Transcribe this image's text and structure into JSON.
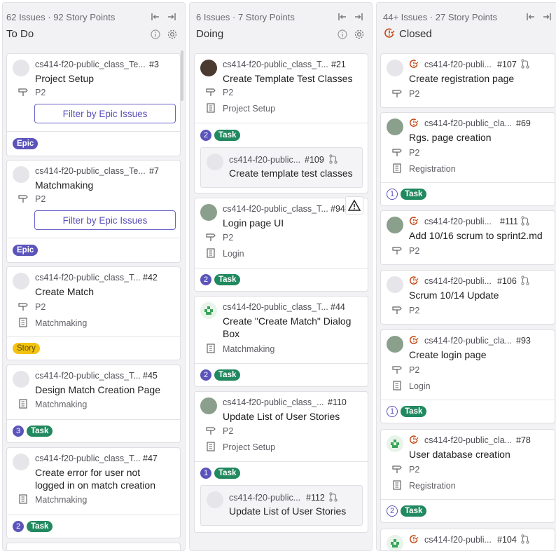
{
  "columns": {
    "todo": {
      "meta": "62 Issues · 92 Story Points",
      "title": "To Do"
    },
    "doing": {
      "meta": "6 Issues · 7 Story Points",
      "title": "Doing"
    },
    "closed": {
      "meta": "44+ Issues · 27 Story Points",
      "title": "Closed"
    }
  },
  "labels": {
    "epic": "Epic",
    "task": "Task",
    "story": "Story",
    "filter_epic": "Filter by Epic Issues"
  },
  "todo_cards": [
    {
      "project": "cs414-f20-public_class_Te...",
      "number": "#3",
      "title": "Project Setup",
      "priority": "P2"
    },
    {
      "project": "cs414-f20-public_class_Te...",
      "number": "#7",
      "title": "Matchmaking",
      "priority": "P2"
    },
    {
      "project": "cs414-f20-public_class_T...",
      "number": "#42",
      "title": "Create Match",
      "priority": "P2",
      "epic": "Matchmaking"
    },
    {
      "project": "cs414-f20-public_class_T...",
      "number": "#45",
      "title": "Design Match Creation Page",
      "epic": "Matchmaking",
      "count": "3"
    },
    {
      "project": "cs414-f20-public_class_T...",
      "number": "#47",
      "title_line1": "Create error for user not",
      "title_line2": "logged in on match creation",
      "epic": "Matchmaking",
      "count": "2"
    }
  ],
  "doing_cards": [
    {
      "project": "cs414-f20-public_class_T...",
      "number": "#21",
      "title": "Create Template Test Classes",
      "priority": "P2",
      "epic": "Project Setup",
      "count": "2",
      "child": {
        "project": "cs414-f20-public...",
        "number": "#109",
        "title": "Create template test classes"
      }
    },
    {
      "project": "cs414-f20-public_class_T...",
      "number": "#94",
      "title": "Login page UI",
      "priority": "P2",
      "epic": "Login",
      "count": "2"
    },
    {
      "project": "cs414-f20-public_class_T...",
      "number": "#44",
      "title_line1": "Create \"Create Match\" Dialog",
      "title_line2": "Box",
      "epic": "Matchmaking",
      "count": "2"
    },
    {
      "project": "cs414-f20-public_class_...",
      "number": "#110",
      "title": "Update List of User Stories",
      "priority": "P2",
      "epic": "Project Setup",
      "count": "1",
      "child": {
        "project": "cs414-f20-public...",
        "number": "#112",
        "title": "Update List of User Stories"
      }
    }
  ],
  "closed_cards": [
    {
      "project": "cs414-f20-publi...",
      "number": "#107",
      "title": "Create registration page",
      "priority": "P2"
    },
    {
      "project": "cs414-f20-public_cla...",
      "number": "#69",
      "title": "Rgs. page creation",
      "priority": "P2",
      "epic": "Registration",
      "count": "1"
    },
    {
      "project": "cs414-f20-publi...",
      "number": "#111",
      "title": "Add 10/16 scrum to sprint2.md",
      "priority": "P2"
    },
    {
      "project": "cs414-f20-publi...",
      "number": "#106",
      "title": "Scrum 10/14 Update",
      "priority": "P2"
    },
    {
      "project": "cs414-f20-public_cla...",
      "number": "#93",
      "title": "Create login page",
      "priority": "P2",
      "epic": "Login",
      "count": "1"
    },
    {
      "project": "cs414-f20-public_cla...",
      "number": "#78",
      "title": "User database creation",
      "priority": "P2",
      "epic": "Registration",
      "count": "2"
    },
    {
      "project": "cs414-f20-publi...",
      "number": "#104"
    }
  ],
  "colors": {
    "epic": "#5b54ba",
    "task": "#21895f",
    "story": "#f2c30f",
    "closed_red": "#c2410c"
  }
}
